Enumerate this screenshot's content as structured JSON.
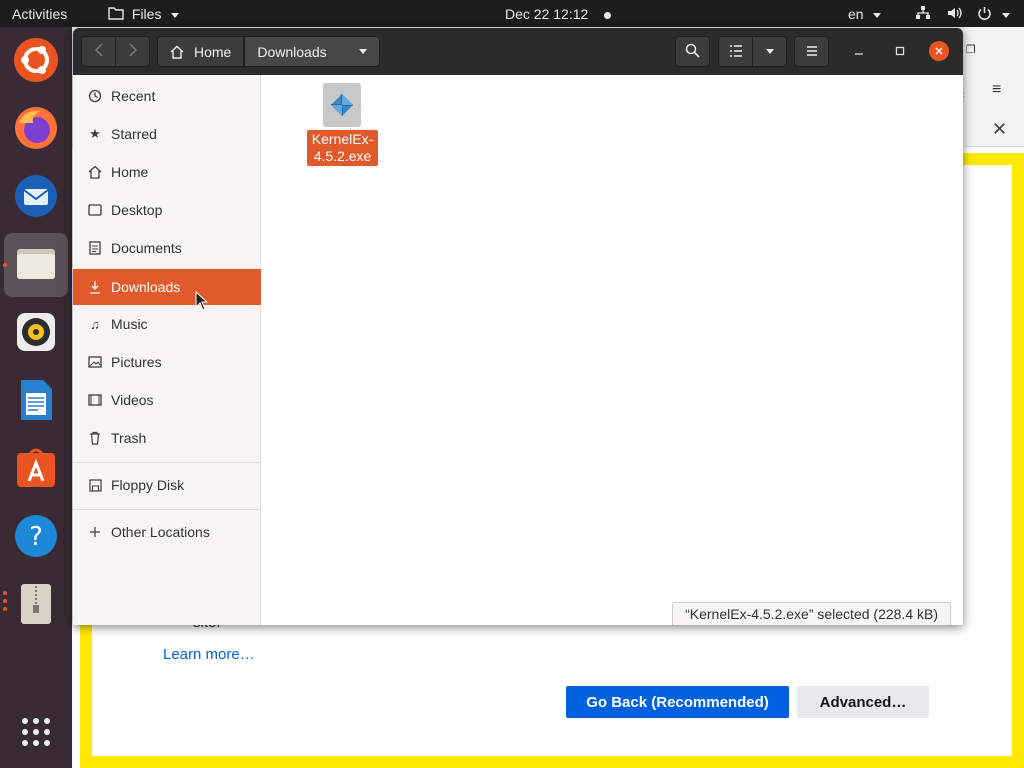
{
  "topbar": {
    "activities": "Activities",
    "app_menu": "Files",
    "clock": "Dec 22  12:12",
    "lang": "en",
    "colors": {
      "bg": "#1d1d1d",
      "text": "#e8e8e8"
    }
  },
  "dock": {
    "apps": [
      {
        "name": "ubuntu-software-icon",
        "active": false
      },
      {
        "name": "firefox-icon",
        "active": false
      },
      {
        "name": "thunderbird-icon",
        "active": false
      },
      {
        "name": "files-icon",
        "active": true
      },
      {
        "name": "rhythmbox-icon",
        "active": false
      },
      {
        "name": "libreoffice-writer-icon",
        "active": false
      },
      {
        "name": "app-store-icon",
        "active": false
      },
      {
        "name": "help-icon",
        "active": false
      },
      {
        "name": "archive-icon",
        "active": false
      },
      {
        "name": "show-apps-icon",
        "active": false
      }
    ],
    "accent": "#e95420"
  },
  "browser_bg": {
    "site_text": "site.",
    "learn_more": "Learn more…",
    "go_back": "Go Back (Recommended)",
    "advanced": "Advanced…",
    "colors": {
      "frame": "#ffe900",
      "primary": "#0061e0",
      "link": "#0060df"
    }
  },
  "files": {
    "breadcrumbs": [
      "Home",
      "Downloads"
    ],
    "sidebar": [
      {
        "label": "Recent",
        "icon": "clock-icon"
      },
      {
        "label": "Starred",
        "icon": "star-icon"
      },
      {
        "label": "Home",
        "icon": "home-icon"
      },
      {
        "label": "Desktop",
        "icon": "desktop-icon"
      },
      {
        "label": "Documents",
        "icon": "document-icon"
      },
      {
        "label": "Downloads",
        "icon": "download-icon",
        "selected": true
      },
      {
        "label": "Music",
        "icon": "music-icon"
      },
      {
        "label": "Pictures",
        "icon": "picture-icon"
      },
      {
        "label": "Videos",
        "icon": "video-icon"
      },
      {
        "label": "Trash",
        "icon": "trash-icon"
      }
    ],
    "devices": [
      {
        "label": "Floppy Disk",
        "icon": "floppy-icon"
      }
    ],
    "other": {
      "label": "Other Locations",
      "icon": "plus-icon"
    },
    "file": {
      "name": "KernelEx-4.5.2.exe",
      "line1": "KernelEx-",
      "line2": "4.5.2.exe"
    },
    "status": "“KernelEx-4.5.2.exe” selected  (228.4 kB)",
    "colors": {
      "selection": "#e05a2b",
      "header": "#2b2b2b",
      "close": "#e95420"
    }
  }
}
